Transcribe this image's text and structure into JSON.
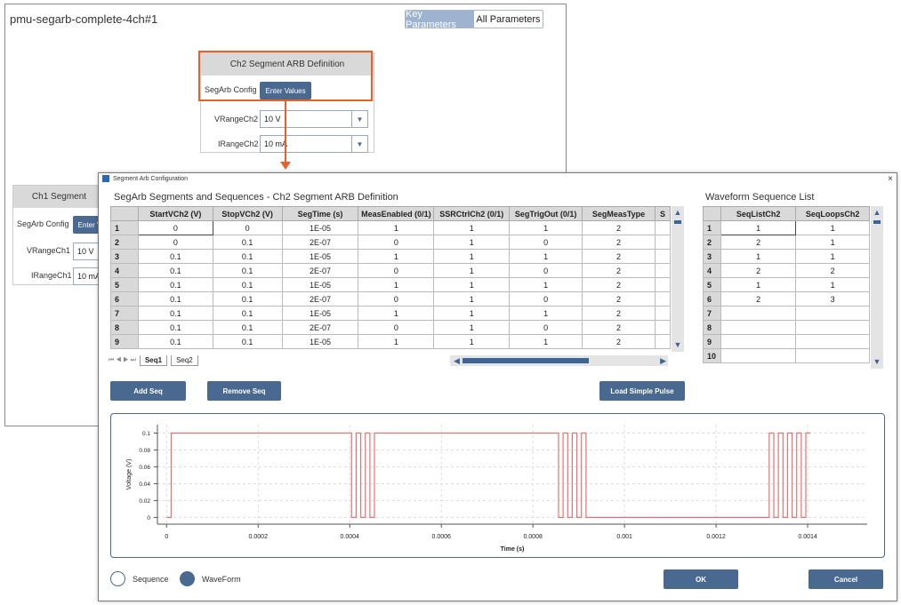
{
  "background": {
    "title": "pmu-segarb-complete-4ch#1",
    "toggle": {
      "key": "Key Parameters",
      "all": "All Parameters"
    },
    "ch2_panel": {
      "header": "Ch2 Segment ARB Definition",
      "segarb_label": "SegArb Config",
      "enter_values": "Enter Values",
      "vrange_label": "VRangeCh2",
      "vrange_value": "10 V",
      "irange_label": "IRangeCh2",
      "irange_value": "10 mA"
    },
    "ch1_panel": {
      "header": "Ch1 Segment",
      "segarb_label": "SegArb Config",
      "enter_values": "Enter V",
      "vrange_label": "VRangeCh1",
      "vrange_value": "10 V",
      "irange_label": "IRangeCh1",
      "irange_value": "10 mA"
    }
  },
  "dialog": {
    "title": "Segment Arb Configuration",
    "close": "×",
    "segments_title": "SegArb Segments and Sequences - Ch2 Segment ARB Definition",
    "segments": {
      "columns": [
        "StartVCh2 (V)",
        "StopVCh2 (V)",
        "SegTime (s)",
        "MeasEnabled (0/1)",
        "SSRCtrlCh2 (0/1)",
        "SegTrigOut (0/1)",
        "SegMeasType",
        "S"
      ],
      "rows": [
        [
          "1",
          "0",
          "0",
          "1E-05",
          "1",
          "1",
          "1",
          "2"
        ],
        [
          "2",
          "0",
          "0.1",
          "2E-07",
          "0",
          "1",
          "0",
          "2"
        ],
        [
          "3",
          "0.1",
          "0.1",
          "1E-05",
          "1",
          "1",
          "1",
          "2"
        ],
        [
          "4",
          "0.1",
          "0.1",
          "2E-07",
          "0",
          "1",
          "0",
          "2"
        ],
        [
          "5",
          "0.1",
          "0.1",
          "1E-05",
          "1",
          "1",
          "1",
          "2"
        ],
        [
          "6",
          "0.1",
          "0.1",
          "2E-07",
          "0",
          "1",
          "0",
          "2"
        ],
        [
          "7",
          "0.1",
          "0.1",
          "1E-05",
          "1",
          "1",
          "1",
          "2"
        ],
        [
          "8",
          "0.1",
          "0.1",
          "2E-07",
          "0",
          "1",
          "0",
          "2"
        ],
        [
          "9",
          "0.1",
          "0.1",
          "1E-05",
          "1",
          "1",
          "1",
          "2"
        ]
      ]
    },
    "sequence_title": "Waveform Sequence List",
    "sequence": {
      "columns": [
        "SeqListCh2",
        "SeqLoopsCh2"
      ],
      "rows": [
        [
          "1",
          "1",
          "1"
        ],
        [
          "2",
          "2",
          "1"
        ],
        [
          "3",
          "1",
          "1"
        ],
        [
          "4",
          "2",
          "2"
        ],
        [
          "5",
          "1",
          "1"
        ],
        [
          "6",
          "2",
          "3"
        ],
        [
          "7",
          "",
          ""
        ],
        [
          "8",
          "",
          ""
        ],
        [
          "9",
          "",
          ""
        ],
        [
          "10",
          "",
          ""
        ]
      ]
    },
    "tabs": [
      "Seq1",
      "Seq2"
    ],
    "buttons": {
      "add_seq": "Add Seq",
      "remove_seq": "Remove Seq",
      "load_simple_pulse": "Load Simple Pulse",
      "ok": "OK",
      "cancel": "Cancel"
    },
    "radios": {
      "sequence": "Sequence",
      "waveform": "WaveForm"
    }
  },
  "chart_data": {
    "type": "line",
    "xlabel": "Time (s)",
    "ylabel": "Voltage (V)",
    "xlim": [
      -2e-05,
      0.00153
    ],
    "ylim": [
      -0.008,
      0.11
    ],
    "xticks": [
      0,
      0.0002,
      0.0004,
      0.0006,
      0.0008,
      0.001,
      0.0012,
      0.0014
    ],
    "xtick_labels": [
      "0",
      "0.0002",
      "0.0004",
      "0.0006",
      "0.0008",
      "0.001",
      "0.0012",
      "0.0014"
    ],
    "yticks": [
      0,
      0.02,
      0.04,
      0.06,
      0.08,
      0.1
    ],
    "ytick_labels": [
      "0",
      "0.02",
      "0.04",
      "0.06",
      "0.08",
      "0.1"
    ],
    "grid": true,
    "color": "#f07070",
    "x": [
      0,
      1e-05,
      1.02e-05,
      0.000404,
      0.000404,
      0.000414,
      0.000414,
      0.000424,
      0.000424,
      0.000434,
      0.000434,
      0.000444,
      0.000444,
      0.000454,
      0.000454,
      0.000856,
      0.000856,
      0.000866,
      0.000866,
      0.000876,
      0.000876,
      0.000886,
      0.000886,
      0.000896,
      0.000896,
      0.000906,
      0.000906,
      0.000916,
      0.000916,
      0.001316,
      0.001316,
      0.001326,
      0.001326,
      0.001336,
      0.001336,
      0.001346,
      0.001346,
      0.001356,
      0.001356,
      0.001366,
      0.001366,
      0.001376,
      0.001376,
      0.001386,
      0.001386,
      0.001396,
      0.001396,
      0.001406
    ],
    "y": [
      0,
      0,
      0.1,
      0.1,
      0,
      0,
      0.1,
      0.1,
      0,
      0,
      0.1,
      0.1,
      0,
      0,
      0.1,
      0.1,
      0,
      0,
      0.1,
      0.1,
      0,
      0,
      0.1,
      0.1,
      0,
      0,
      0.1,
      0.1,
      0,
      0,
      0.1,
      0.1,
      0,
      0,
      0.1,
      0.1,
      0,
      0,
      0.1,
      0.1,
      0,
      0,
      0.1,
      0.1,
      0,
      0,
      0.1,
      0.1
    ]
  }
}
